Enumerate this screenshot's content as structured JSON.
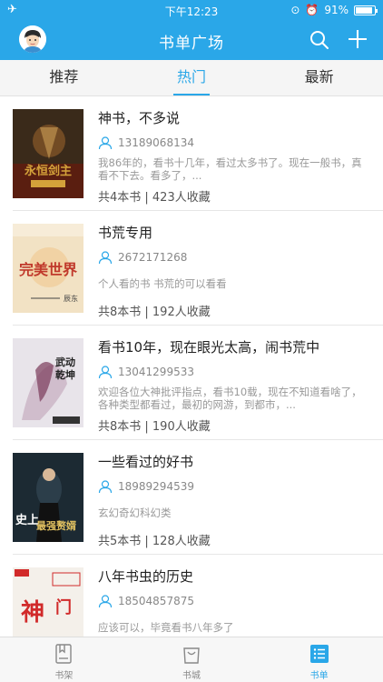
{
  "status": {
    "time": "下午12:23",
    "battery": "91%",
    "battery_level": 0.91
  },
  "nav": {
    "title": "书单广场"
  },
  "tabs": [
    {
      "label": "推荐",
      "active": false
    },
    {
      "label": "热门",
      "active": true
    },
    {
      "label": "最新",
      "active": false
    }
  ],
  "booklists": [
    {
      "title": "神书，不多说",
      "author": "13189068134",
      "description": "我86年的，看书十几年，看过太多书了。现在一般书，真看不下去。看多了，...",
      "stats": "共4本书 | 423人收藏",
      "cover_color": "#3a2a1a",
      "cover_accent": "#d4a23a",
      "cover_text": "永恒剑主"
    },
    {
      "title": "书荒专用",
      "author": "2672171268",
      "description": "个人看的书 书荒的可以看看",
      "stats": "共8本书 | 192人收藏",
      "cover_color": "#f2e2c4",
      "cover_accent": "#c0392b",
      "cover_text": "完美世界"
    },
    {
      "title": "看书10年，现在眼光太高，闹书荒中",
      "author": "13041299533",
      "description": "欢迎各位大神批评指点，看书10载，现在不知道看啥了，各种类型都看过，最初的网游，到都市，...",
      "stats": "共8本书 | 190人收藏",
      "cover_color": "#e8e4ea",
      "cover_accent": "#7a3a5a",
      "cover_text": "武动乾坤"
    },
    {
      "title": "一些看过的好书",
      "author": "18989294539",
      "description": "玄幻奇幻科幻类",
      "stats": "共5本书 | 128人收藏",
      "cover_color": "#1c2a33",
      "cover_accent": "#e0c060",
      "cover_text": "史上最强赘婿"
    },
    {
      "title": "八年书虫的历史",
      "author": "18504857875",
      "description": "应该可以，毕竟看书八年多了",
      "stats": "",
      "cover_color": "#f4f0ea",
      "cover_accent": "#d12a2a",
      "cover_text": "神门"
    }
  ],
  "tabbar": [
    {
      "label": "书架",
      "icon": "bookshelf-icon",
      "active": false
    },
    {
      "label": "书城",
      "icon": "bookstore-bag-icon",
      "active": false
    },
    {
      "label": "书单",
      "icon": "booklist-icon",
      "active": true
    }
  ],
  "colors": {
    "primary": "#2aa7e8"
  }
}
